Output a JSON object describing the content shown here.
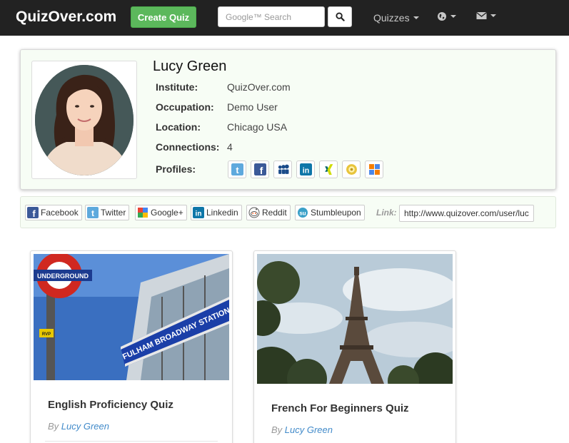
{
  "navbar": {
    "brand": "QuizOver.com",
    "create_quiz": "Create Quiz",
    "search_placeholder": "Google™ Search",
    "quizzes": "Quizzes"
  },
  "profile": {
    "name": "Lucy Green",
    "rows": [
      {
        "label": "Institute:",
        "value": "QuizOver.com"
      },
      {
        "label": "Occupation:",
        "value": "Demo User"
      },
      {
        "label": "Location:",
        "value": "Chicago USA"
      },
      {
        "label": "Connections:",
        "value": "4"
      }
    ],
    "profiles_label": "Profiles:",
    "profile_icons": [
      "twitter-icon",
      "facebook-icon",
      "myspace-icon",
      "linkedin-icon",
      "xing-icon",
      "delicious-icon",
      "blogger-icon"
    ]
  },
  "share": {
    "buttons": [
      "Facebook",
      "Twitter",
      "Google+",
      "Linkedin",
      "Reddit",
      "Stumbleupon"
    ],
    "link_label": "Link:",
    "link_value": "http://www.quizover.com/user/lucy"
  },
  "quizzes": [
    {
      "title": "English Proficiency Quiz",
      "by": "By",
      "author": "Lucy Green"
    },
    {
      "title": "French For Beginners Quiz",
      "by": "By",
      "author": "Lucy Green"
    }
  ],
  "colors": {
    "navbar_bg": "#222222",
    "create_button": "#5cb85c",
    "card_bg": "#f7fdf5",
    "author_link": "#428bca"
  }
}
